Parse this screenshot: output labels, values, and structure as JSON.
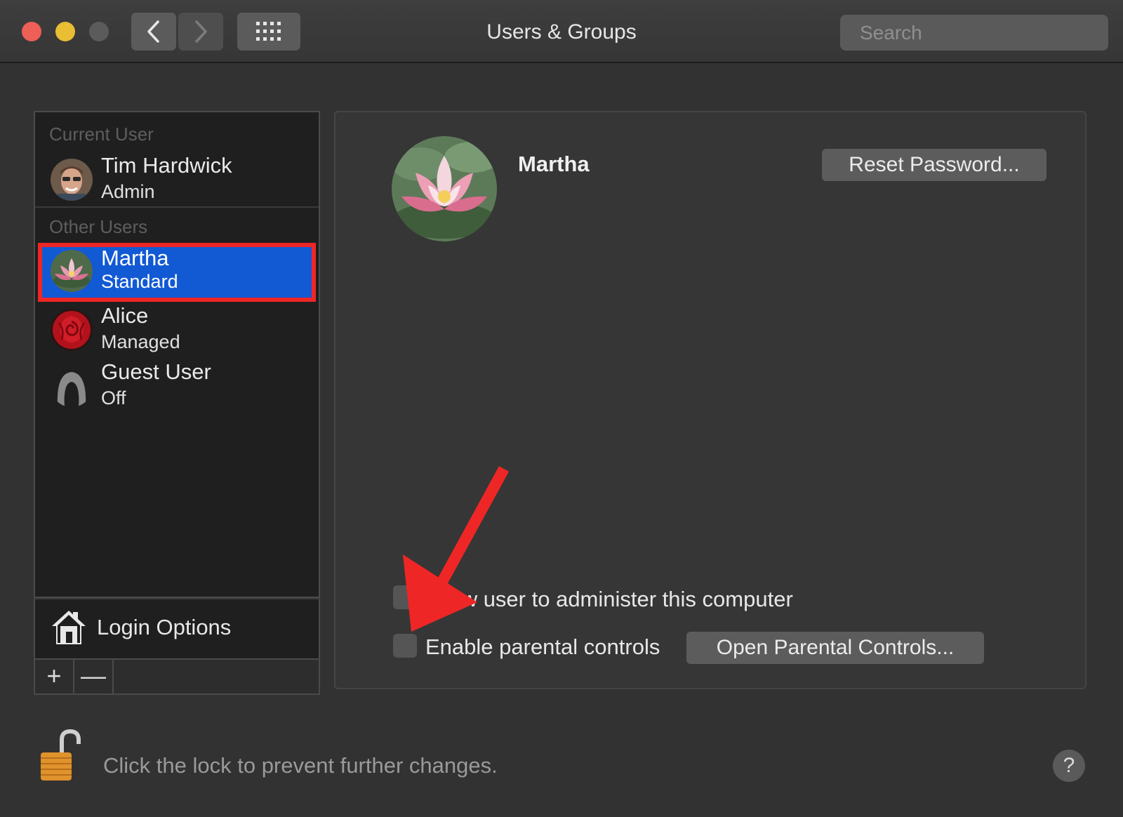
{
  "window": {
    "title": "Users & Groups",
    "search_placeholder": "Search"
  },
  "sidebar": {
    "current_user_header": "Current User",
    "current_user": {
      "name": "Tim Hardwick",
      "role": "Admin"
    },
    "other_users_header": "Other Users",
    "other_users": [
      {
        "name": "Martha",
        "role": "Standard",
        "selected": true
      },
      {
        "name": "Alice",
        "role": "Managed"
      },
      {
        "name": "Guest User",
        "role": "Off"
      }
    ],
    "login_options_label": "Login Options",
    "add_label": "+",
    "remove_label": "—"
  },
  "detail": {
    "user_name": "Martha",
    "reset_password_label": "Reset Password...",
    "allow_admin_label": "Allow user to administer this computer",
    "enable_parental_label": "Enable parental controls",
    "open_parental_label": "Open Parental Controls..."
  },
  "footer": {
    "lock_text": "Click the lock to prevent further changes.",
    "help_label": "?"
  },
  "colors": {
    "selection": "#1259d4",
    "annotation_red": "#ef2626"
  }
}
